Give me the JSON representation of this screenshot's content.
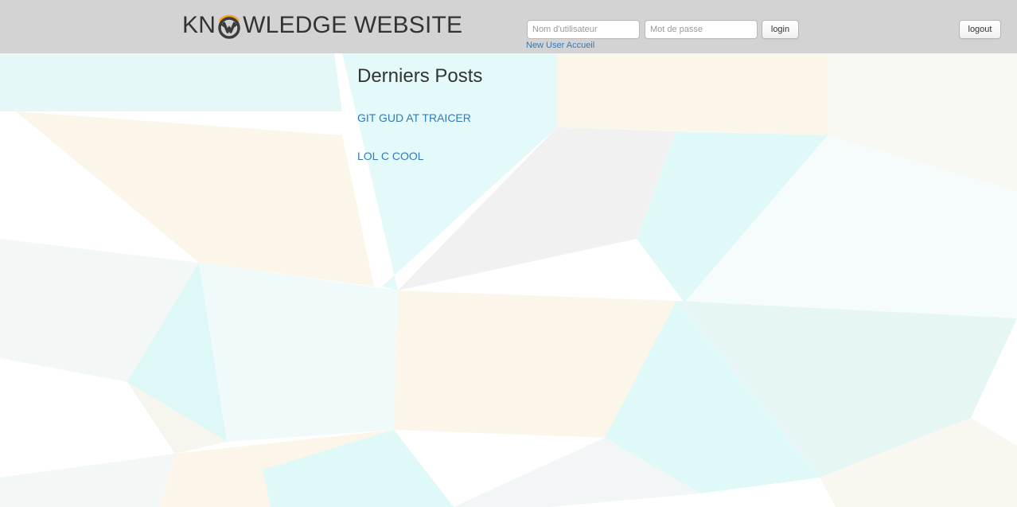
{
  "header": {
    "logo_prefix": "KN",
    "logo_suffix": "WLEDGE WEBSITE",
    "logo_emblem_icon": "overwatch-emblem-icon",
    "username_placeholder": "Nom d'utilisateur",
    "password_placeholder": "Mot de passe",
    "login_label": "login",
    "new_user_link": "New User Accueil",
    "logout_label": "logout"
  },
  "main": {
    "title": "Derniers Posts",
    "posts": [
      {
        "title": "GIT GUD AT TRAICER"
      },
      {
        "title": "LOL C COOL"
      }
    ]
  },
  "colors": {
    "header_bg": "#d3d3d3",
    "link": "#337ab7",
    "text": "#333333",
    "logo_accent": "#f99e1a"
  }
}
